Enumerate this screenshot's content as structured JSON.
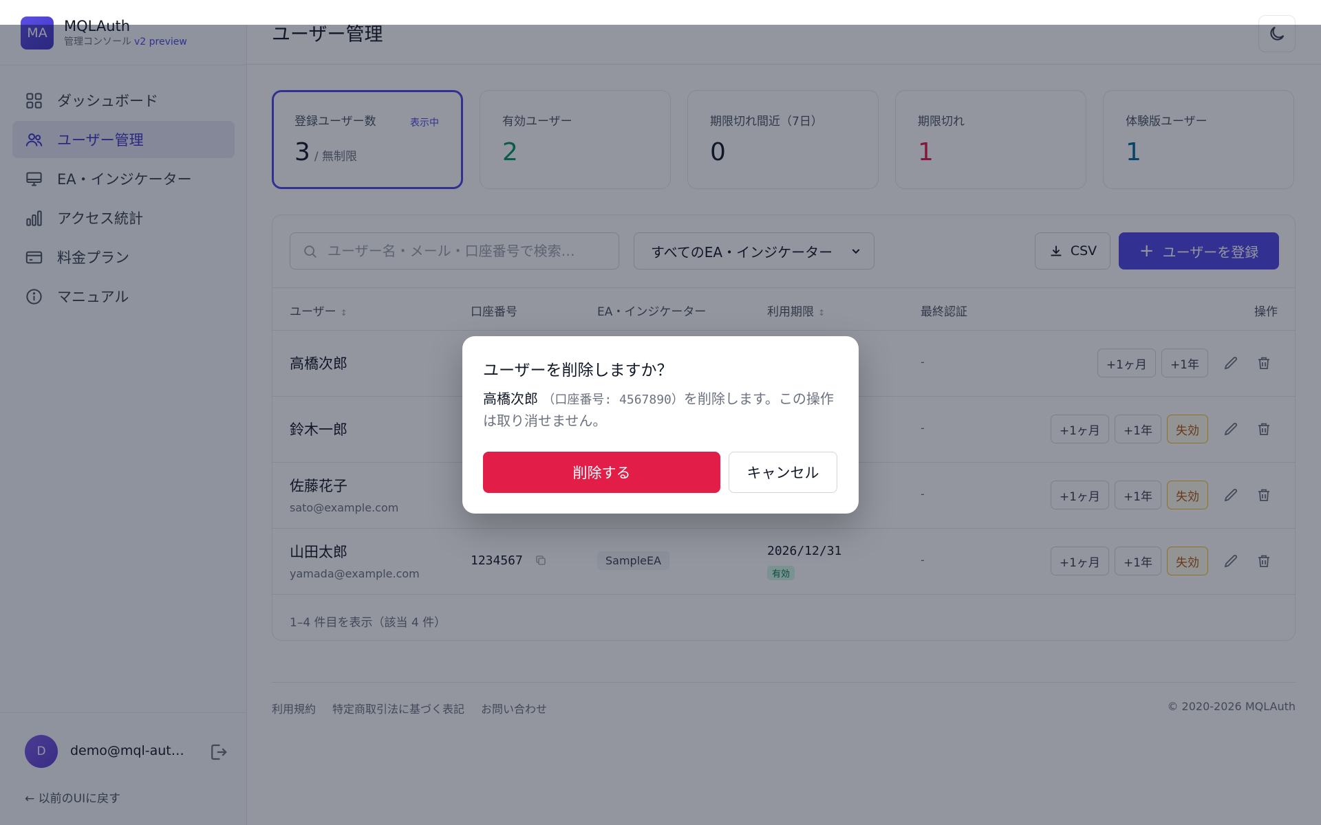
{
  "app": {
    "logo_text": "MA",
    "name": "MQLAuth",
    "subtitle": "管理コンソール",
    "version": "v2 preview"
  },
  "sidebar": {
    "items": [
      {
        "label": "ダッシュボード",
        "icon": "grid-icon"
      },
      {
        "label": "ユーザー管理",
        "icon": "users-icon",
        "active": true
      },
      {
        "label": "EA・インジケーター",
        "icon": "monitor-icon"
      },
      {
        "label": "アクセス統計",
        "icon": "bar-chart-icon"
      },
      {
        "label": "料金プラン",
        "icon": "credit-card-icon"
      },
      {
        "label": "マニュアル",
        "icon": "info-icon"
      }
    ],
    "user": {
      "avatar": "D",
      "email": "demo@mql-auth.com"
    },
    "back_link": "← 以前のUIに戻す"
  },
  "page": {
    "title": "ユーザー管理"
  },
  "stats": [
    {
      "label": "登録ユーザー数",
      "badge": "表示中",
      "value": "3",
      "sub": "/ 無制限"
    },
    {
      "label": "有効ユーザー",
      "value": "2",
      "color": "#059669"
    },
    {
      "label": "期限切れ間近（7日）",
      "value": "0"
    },
    {
      "label": "期限切れ",
      "value": "1",
      "color": "#e11d48"
    },
    {
      "label": "体験版ユーザー",
      "value": "1",
      "color": "#0369a1"
    }
  ],
  "toolbar": {
    "search_placeholder": "ユーザー名・メール・口座番号で検索…",
    "filter_selected": "すべてのEA・インジケーター",
    "csv_label": "CSV",
    "add_label": "ユーザーを登録"
  },
  "table": {
    "headers": {
      "user": "ユーザー",
      "account": "口座番号",
      "ea": "EA・インジケーター",
      "expiry": "利用期限",
      "last_auth": "最終認証",
      "actions": "操作"
    },
    "sort_glyph": "↕",
    "rows": [
      {
        "name": "高橋次郎",
        "email": "",
        "last_auth": "-",
        "warn": ""
      },
      {
        "name": "鈴木一郎",
        "email": "",
        "last_auth": "-",
        "warn": "失効"
      },
      {
        "name": "佐藤花子",
        "email": "sato@example.com",
        "last_auth": "-",
        "warn": "失効"
      },
      {
        "name": "山田太郎",
        "email": "yamada@example.com",
        "account": "1234567",
        "ea": "SampleEA",
        "expiry": "2026/12/31",
        "status": "有効",
        "last_auth": "-",
        "warn": "失効"
      }
    ],
    "btn_month": "+1ヶ月",
    "btn_year": "+1年",
    "footer": "1–4 件目を表示（該当 4 件）"
  },
  "footer": {
    "links": [
      "利用規約",
      "特定商取引法に基づく表記",
      "お問い合わせ"
    ],
    "copyright": "© 2020-2026 MQLAuth"
  },
  "modal": {
    "title": "ユーザーを削除しますか？",
    "target_name": "高橋次郎",
    "body_account": "（口座番号: 4567890）",
    "body_rest": "を削除します。この操作は取り消せません。",
    "delete_label": "削除する",
    "cancel_label": "キャンセル"
  },
  "colors": {
    "accent": "#4f46e5",
    "danger": "#e11d48",
    "success": "#059669"
  }
}
